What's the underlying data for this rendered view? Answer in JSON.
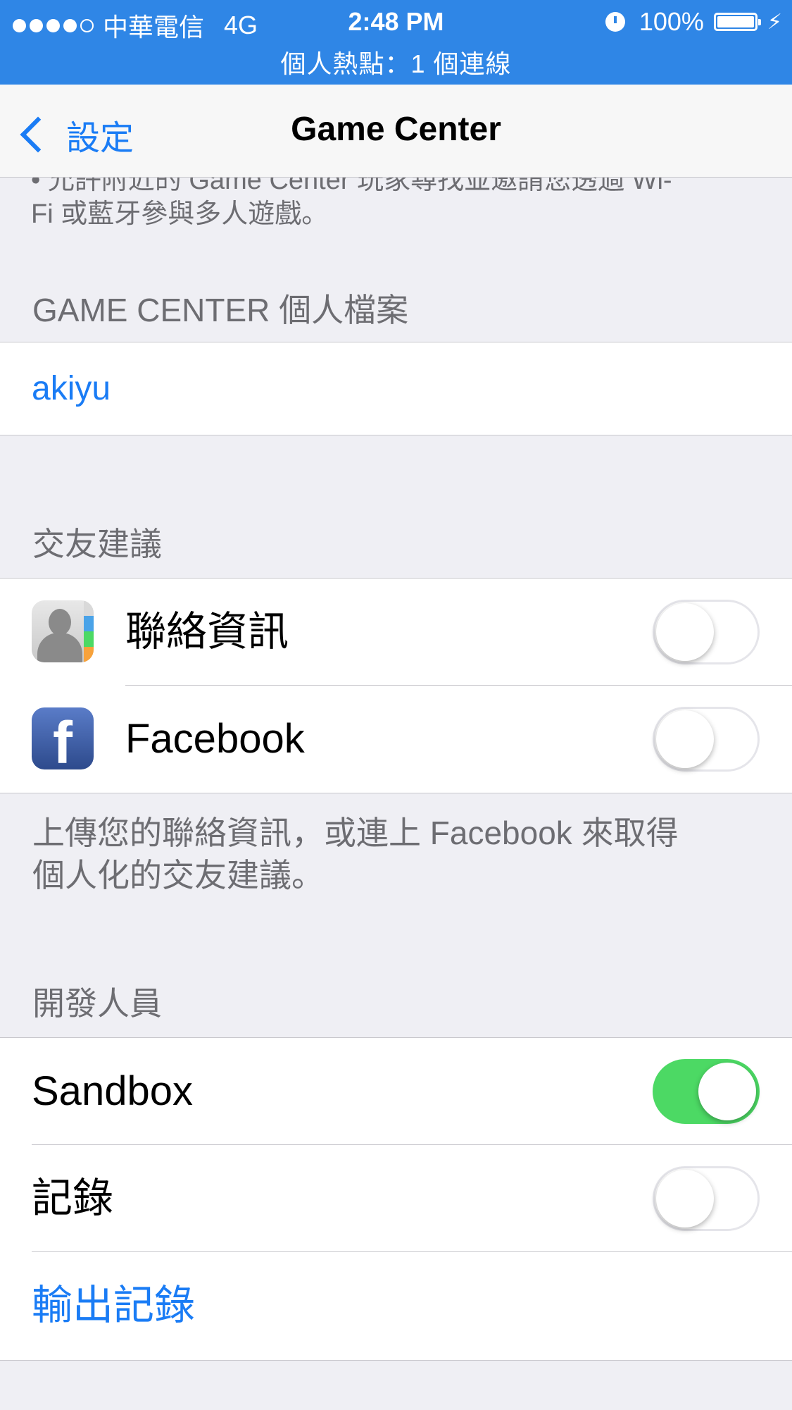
{
  "status_bar": {
    "carrier": "中華電信",
    "network": "4G",
    "time": "2:48 PM",
    "battery": "100%",
    "hotspot": "個人熱點：1 個連線",
    "signal_bars": 4,
    "signal_max": 5
  },
  "nav": {
    "back_label": "設定",
    "title": "Game Center"
  },
  "top_note": {
    "line1": "• 允許附近的 Game Center 玩家尋找並邀請您透過 Wi-",
    "line2": "Fi 或藍牙參與多人遊戲。"
  },
  "profile_section": {
    "header": "GAME CENTER 個人檔案",
    "username": "akiyu"
  },
  "friends_section": {
    "header": "交友建議",
    "rows": [
      {
        "label": "聯絡資訊",
        "icon": "contacts-icon",
        "on": false
      },
      {
        "label": "Facebook",
        "icon": "facebook-icon",
        "on": false
      }
    ],
    "footer_line1": "上傳您的聯絡資訊，或連上 Facebook 來取得",
    "footer_line2": "個人化的交友建議。"
  },
  "developer_section": {
    "header": "開發人員",
    "sandbox": {
      "label": "Sandbox",
      "on": true
    },
    "logging": {
      "label": "記錄",
      "on": false
    },
    "export_logs": "輸出記錄"
  },
  "colors": {
    "status_bar": "#2f86e6",
    "accent": "#1a7cf5",
    "toggle_on": "#4cd964",
    "background": "#efeff4"
  }
}
